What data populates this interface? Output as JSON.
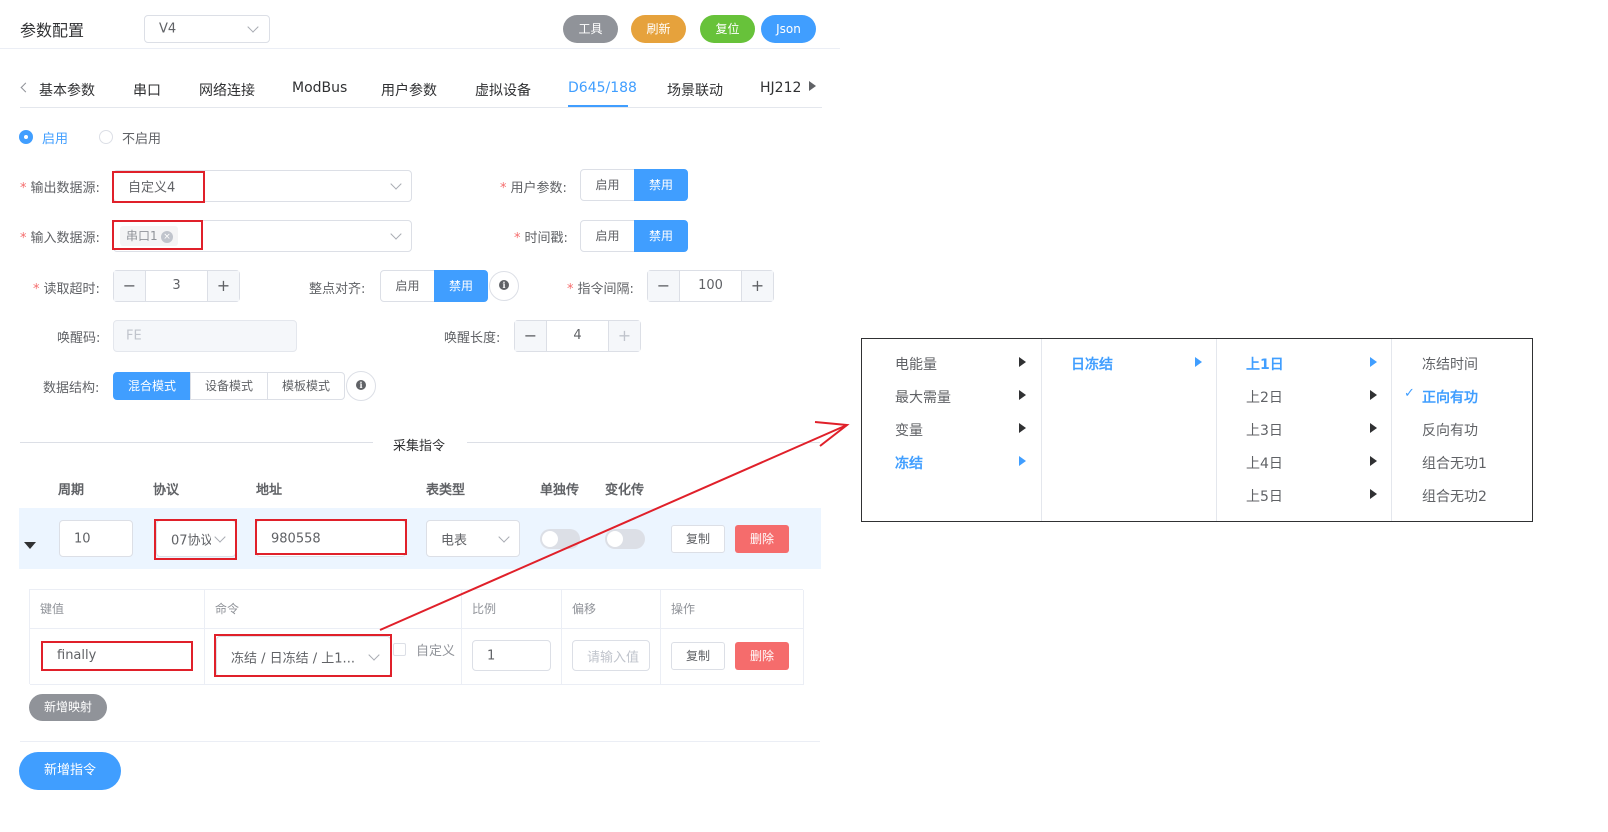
{
  "header": {
    "title": "参数配置",
    "version": "V4",
    "buttons": [
      {
        "label": "工具",
        "color": "#909399"
      },
      {
        "label": "刷新",
        "color": "#e6a23c"
      },
      {
        "label": "复位",
        "color": "#67c23a"
      },
      {
        "label": "Json",
        "color": "#409eff"
      }
    ]
  },
  "tabs": [
    "基本参数",
    "串口",
    "网络连接",
    "ModBus",
    "用户参数",
    "虚拟设备",
    "D645/188",
    "场景联动",
    "HJ212"
  ],
  "active_tab": "D645/188",
  "enable": {
    "on": "启用",
    "off": "不启用"
  },
  "form": {
    "output_source": {
      "label": "输出数据源:",
      "value": "自定义4"
    },
    "input_source": {
      "label": "输入数据源:",
      "tag": "串口1"
    },
    "user_params": {
      "label": "用户参数:",
      "on": "启用",
      "off": "禁用"
    },
    "timestamp": {
      "label": "时间戳:",
      "on": "启用",
      "off": "禁用"
    },
    "read_timeout": {
      "label": "读取超时:",
      "value": "3"
    },
    "hour_align": {
      "label": "整点对齐:",
      "on": "启用",
      "off": "禁用"
    },
    "cmd_interval": {
      "label": "指令间隔:",
      "value": "100"
    },
    "wake_code": {
      "label": "唤醒码:",
      "placeholder": "FE"
    },
    "wake_length": {
      "label": "唤醒长度:",
      "value": "4"
    },
    "data_struct": {
      "label": "数据结构:",
      "options": [
        "混合模式",
        "设备模式",
        "模板模式"
      ]
    }
  },
  "section_title": "采集指令",
  "cmd_table": {
    "headers": [
      "周期",
      "协议",
      "地址",
      "表类型",
      "单独传",
      "变化传"
    ],
    "row": {
      "period": "10",
      "protocol": "07协议",
      "address": "980558",
      "meter_type": "电表",
      "copy": "复制",
      "delete": "删除"
    }
  },
  "map_table": {
    "headers": [
      "键值",
      "命令",
      "比例",
      "偏移",
      "操作"
    ],
    "row": {
      "key": "finally",
      "command": "冻结 / 日冻结 / 上1...",
      "custom": "自定义",
      "ratio": "1",
      "offset_placeholder": "请输入值",
      "copy": "复制",
      "delete": "删除"
    }
  },
  "add_mapping": "新增映射",
  "add_command": "新增指令",
  "cascader": {
    "col1": [
      "电能量",
      "最大需量",
      "变量",
      "冻结"
    ],
    "col2": [
      "日冻结"
    ],
    "col3": [
      "上1日",
      "上2日",
      "上3日",
      "上4日",
      "上5日"
    ],
    "col4": [
      "冻结时间",
      "正向有功",
      "反向有功",
      "组合无功1",
      "组合无功2"
    ],
    "check": "✓"
  }
}
